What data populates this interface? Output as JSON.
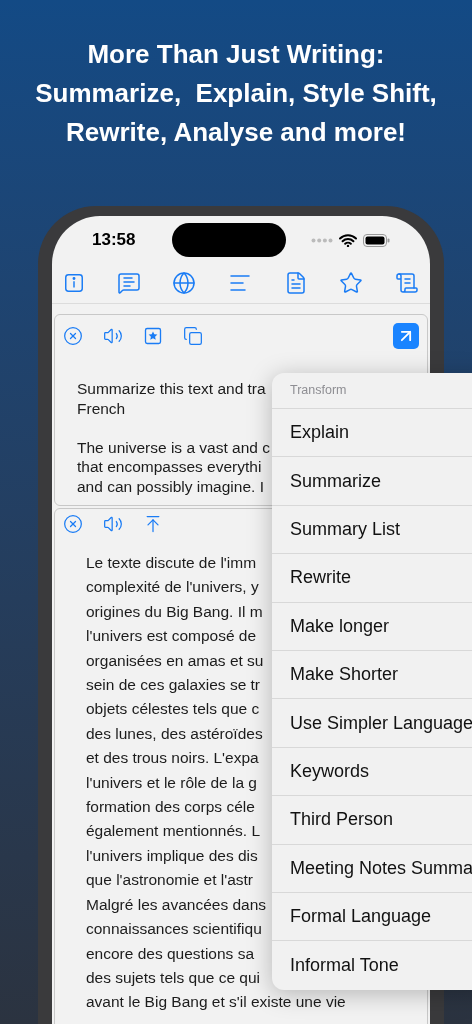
{
  "headline": [
    "More Than Just Writing:",
    "Summarize,  Explain, Style Shift,",
    "Rewrite, Analyse and more!"
  ],
  "status_bar": {
    "time": "13:58"
  },
  "prompt_panel": {
    "paragraphs": [
      [
        "Summarize this text and tra",
        "French"
      ],
      [
        "The universe is a vast and c",
        "that encompasses everythi",
        "and can possibly imagine. I"
      ]
    ]
  },
  "result_panel": {
    "lines": [
      "Le texte discute de l'imm",
      "complexité de l'univers, y",
      "origines du Big Bang. Il m",
      "l'univers est composé de",
      "organisées en amas et su",
      "sein de ces galaxies se tr",
      "objets célestes tels que c",
      "des lunes, des astéroïdes",
      "et des trous noirs. L'expa",
      "l'univers et le rôle de la g",
      "formation des corps céle",
      "également mentionnés. L",
      "l'univers implique des dis",
      "que l'astronomie et l'astr",
      "Malgré les avancées dans",
      "connaissances scientifiqu",
      "encore des questions sa",
      "des sujets tels que ce qui",
      "avant le Big Bang et s'il existe une vie"
    ]
  },
  "menu": {
    "header": "Transform",
    "items": [
      "Explain",
      "Summarize",
      "Summary List",
      "Rewrite",
      "Make longer",
      "Make Shorter",
      "Use Simpler Language",
      "Keywords",
      "Third Person",
      "Meeting Notes Summa",
      "Formal Language",
      "Informal Tone"
    ]
  }
}
